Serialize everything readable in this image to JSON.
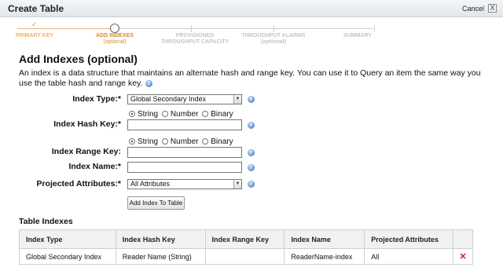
{
  "window": {
    "title": "Create Table",
    "cancel_label": "Cancel",
    "close_glyph": "X"
  },
  "wizard": {
    "check_glyph": "✓",
    "steps": [
      {
        "label": "PRIMARY KEY",
        "sub": ""
      },
      {
        "label": "ADD INDEXES",
        "sub": "(optional)"
      },
      {
        "label": "PROVISIONED",
        "sub": "THROUGHPUT CAPACITY"
      },
      {
        "label": "THROUGHPUT ALARMS",
        "sub": "(optional)"
      },
      {
        "label": "SUMMARY",
        "sub": ""
      }
    ]
  },
  "section": {
    "title": "Add Indexes (optional)",
    "description": "An index is a data structure that maintains an alternate hash and range key. You can use it to Query an item the same way you use the table hash and range key."
  },
  "help_glyph": "?",
  "form": {
    "index_type": {
      "label": "Index Type:*",
      "value": "Global Secondary Index"
    },
    "hash_key": {
      "label": "Index Hash Key:*",
      "value": "",
      "types": [
        "String",
        "Number",
        "Binary"
      ],
      "selected_type": "String"
    },
    "range_key": {
      "label": "Index Range Key:",
      "value": "",
      "types": [
        "String",
        "Number",
        "Binary"
      ],
      "selected_type": "String"
    },
    "index_name": {
      "label": "Index Name:*",
      "value": ""
    },
    "projected": {
      "label": "Projected Attributes:*",
      "value": "All Attributes"
    },
    "add_button": "Add Index To Table",
    "select_arrow": "▼"
  },
  "table_indexes": {
    "title": "Table Indexes",
    "columns": [
      "Index Type",
      "Index Hash Key",
      "Index Range Key",
      "Index Name",
      "Projected Attributes",
      ""
    ],
    "rows": [
      {
        "type": "Global Secondary Index",
        "hash_key": "Reader Name (String)",
        "range_key": "",
        "name": "ReaderName-index",
        "projected": "All",
        "delete_glyph": "✕"
      }
    ]
  },
  "colors": {
    "accent_orange": "#d68a2e",
    "help_blue": "#3a73c0",
    "delete_red": "#cc1f1f"
  }
}
